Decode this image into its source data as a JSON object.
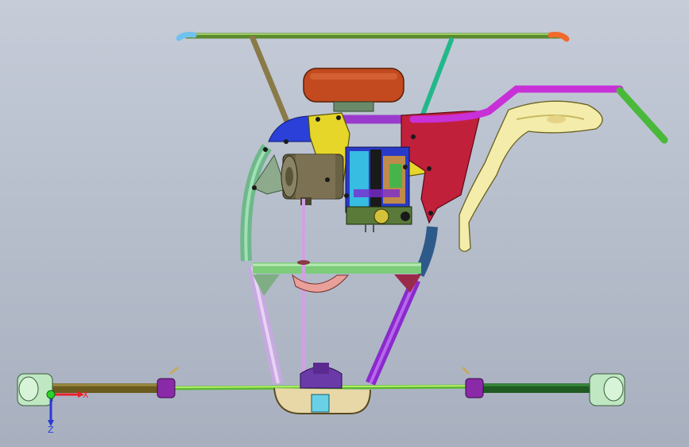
{
  "view": {
    "colors": {
      "background_top": "#c6ccd8",
      "background_bottom": "#a8b0bf"
    }
  },
  "triad": {
    "x_label": "X",
    "z_label": "Z",
    "x_color": "#e8202a",
    "y_color": "#2bd12b",
    "z_color": "#2a39d8"
  }
}
